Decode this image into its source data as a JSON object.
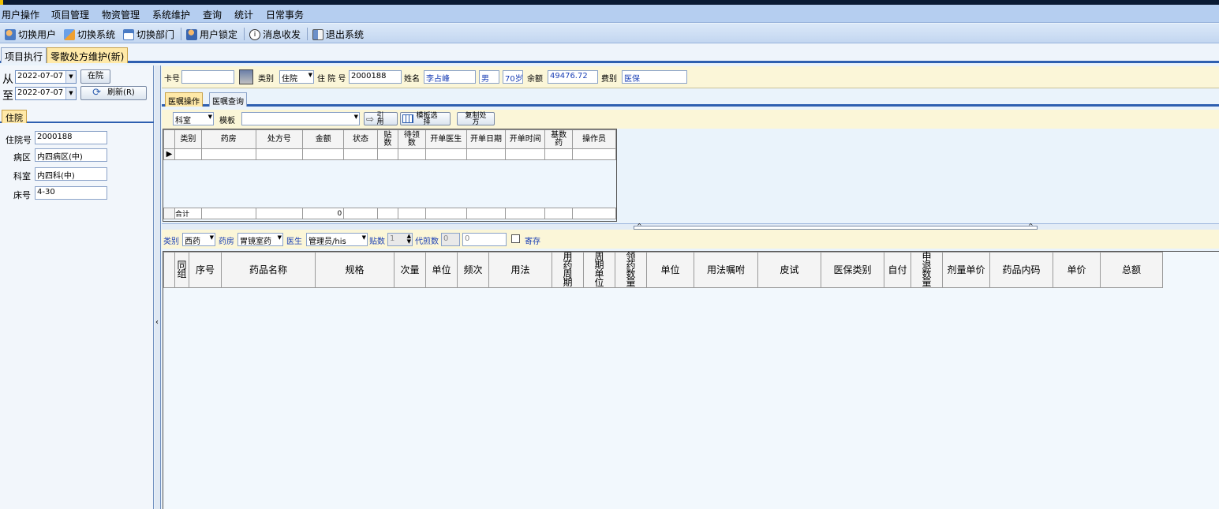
{
  "menu": [
    "用户操作",
    "项目管理",
    "物资管理",
    "系统维护",
    "查询",
    "统计",
    "日常事务"
  ],
  "toolbar": {
    "switch_user": "切换用户",
    "switch_system": "切换系统",
    "switch_dept": "切换部门",
    "lock_user": "用户锁定",
    "messages": "消息收发",
    "exit": "退出系统"
  },
  "tabs": [
    "项目执行",
    "零散处方维护(新)"
  ],
  "left": {
    "from_label": "从",
    "to_label": "至",
    "from_date": "2022-07-07",
    "to_date": "2022-07-07",
    "in_hospital_button": "在院",
    "refresh_button": "刷新(R)",
    "tab": "住院",
    "fields": [
      {
        "label": "住院号",
        "value": "2000188"
      },
      {
        "label": "病区",
        "value": "内四病区(中)"
      },
      {
        "label": "科室",
        "value": "内四科(中)"
      },
      {
        "label": "床号",
        "value": "4-30"
      }
    ]
  },
  "patient": {
    "card_label": "卡号",
    "card_value": "",
    "type_label": "类别",
    "type_value": "住院",
    "admission_label": "住 院 号",
    "admission_value": "2000188",
    "name_label": "姓名",
    "name_value": "李占峰",
    "gender": "男",
    "age": "70岁",
    "balance_label": "余额",
    "balance_value": "49476.72",
    "fee_type_label": "费别",
    "fee_type_value": "医保"
  },
  "subtabs": [
    "医嘱操作",
    "医嘱查询"
  ],
  "template_row": {
    "dept_value": "科室",
    "template_label": "模板",
    "template_value": "",
    "cite_button": "引用",
    "template_select_button": "模板选择",
    "copy_button": "复制处方"
  },
  "grid1": {
    "headers": [
      "类别",
      "药房",
      "处方号",
      "金额",
      "状态",
      "贴数",
      "待领数",
      "开单医生",
      "开单日期",
      "开单时间",
      "基数药",
      "操作员"
    ],
    "summary_label": "合计",
    "summary_amount": "0"
  },
  "filter": {
    "category_label": "类别",
    "category_value": "西药",
    "pharmacy_label": "药房",
    "pharmacy_value": "胃镜室药",
    "doctor_label": "医生",
    "doctor_value": "管理员/his",
    "doses_label": "贴数",
    "doses_value": "1",
    "decoct_label": "代煎数",
    "decoct_value": "0",
    "decoct_value2": "0",
    "save_label": "寄存"
  },
  "grid2": {
    "headers": [
      "同组",
      "序号",
      "药品名称",
      "规格",
      "次量",
      "单位",
      "频次",
      "用法",
      "用药周期",
      "周期单位",
      "领药数量",
      "单位",
      "用法嘱咐",
      "皮试",
      "医保类别",
      "自付",
      "申退数量",
      "剂量单价",
      "药品内码",
      "单价",
      "总额"
    ]
  }
}
